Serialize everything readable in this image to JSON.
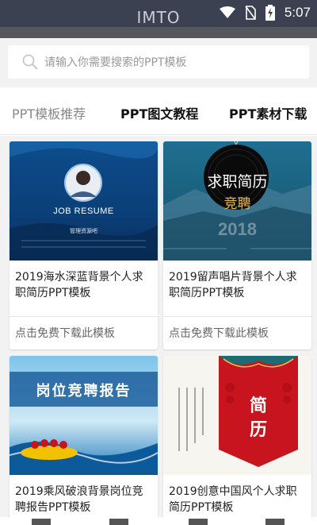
{
  "status_bar": {
    "app_title": "IMTO",
    "time": "5:07",
    "icons": [
      "wifi-icon",
      "no-sim-icon",
      "battery-charging-icon"
    ]
  },
  "search": {
    "placeholder": "请输入你需要搜索的PPT模板",
    "icon": "search-icon"
  },
  "tabs": [
    {
      "label": "PPT模板推荐",
      "selected": true
    },
    {
      "label": "PPT图文教程",
      "selected": false
    },
    {
      "label": "PPT素材下载",
      "selected": false
    }
  ],
  "cards": [
    {
      "title": "2019海水深蓝背景个人求职简历PPT模板",
      "download": "点击免费下载此模板",
      "thumb_text": {
        "main": "JOB RESUME",
        "sub": "管理资源吧"
      }
    },
    {
      "title": "2019留声唱片背景个人求职简历PPT模板",
      "download": "点击免费下载此模板",
      "thumb_text": {
        "main": "求职简历",
        "sub": "竞聘",
        "year": "2018"
      }
    },
    {
      "title": "2019乘风破浪背景岗位竞聘报告PPT模板",
      "download": "",
      "thumb_text": {
        "main": "岗位竞聘报告"
      }
    },
    {
      "title": "2019创意中国风个人求职简历PPT模板",
      "download": "",
      "thumb_text": {
        "main": "简历"
      }
    }
  ],
  "colors": {
    "status_bar": "#3b4150",
    "accent_blue": "#1e6fb0",
    "red": "#c8141e"
  }
}
